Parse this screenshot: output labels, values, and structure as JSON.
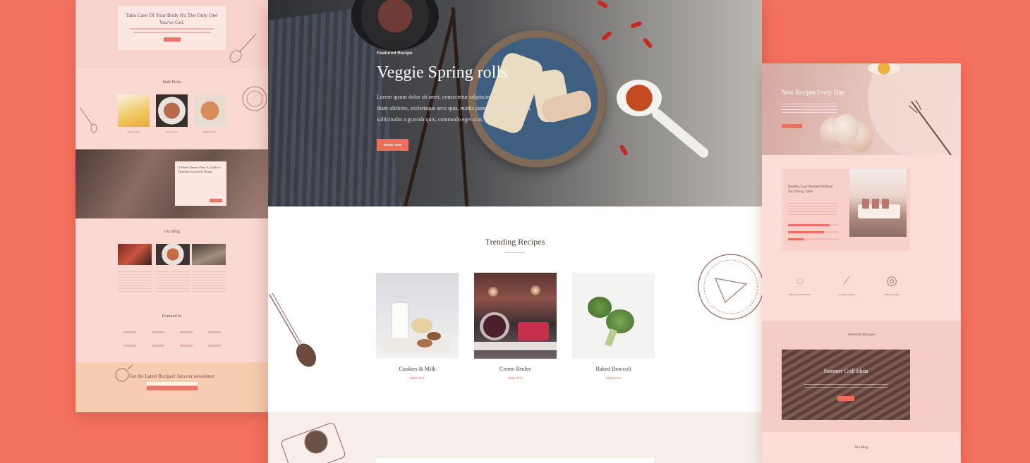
{
  "colors": {
    "background": "#f4735f",
    "accent": "#ee6e5e",
    "pink_bg": "#fbd9d3",
    "dark_text": "#4a3a37"
  },
  "left_mockup": {
    "top_card_title": "Take Care Of Your Body It's The Only One You've Got.",
    "staff_picks_title": "Staff Picks",
    "staff_picks": [
      {
        "caption": "Orange Juice"
      },
      {
        "caption": "Roast Crab"
      },
      {
        "caption": "Baked Bread"
      }
    ],
    "feature_card_title": "4-Week Dinner Plan: A Guide to Healthier Lunch & Dinner",
    "blog_title": "Our Blog",
    "blog_posts": [
      {
        "title": "Summer Grill Ideas"
      },
      {
        "title": "Best Crabbed Recipe Pakastan"
      },
      {
        "title": "Baking Bread at Home"
      }
    ],
    "featured_in_title": "Featured In",
    "newsletter_title": "Get the Latest Recipes! Join our newsletter"
  },
  "center_mockup": {
    "hero": {
      "label": "Featured Recipe",
      "title": "Veggie Spring rolls",
      "text": "Lorem ipsum dolor sit amet, consectetur adipiscing elit. Sed nec diam ultricies, scelerisque arcu quis, mattis purus. Morbi tellus nibh, sollicitudin a gravida quis, commodo eget cras.",
      "button": "MAKE THIS"
    },
    "trending_title": "Trending Recipes",
    "recipes": [
      {
        "name": "Cookies & Milk",
        "link": "Make This"
      },
      {
        "name": "Creme Brulee",
        "link": "Make This"
      },
      {
        "name": "Baked Broccoli",
        "link": "Make This"
      }
    ]
  },
  "right_mockup": {
    "hero_title": "New Recipes Every Day",
    "block_title": "Healthy Easy Recipes Without Sacrificing Taste",
    "progress": [
      0.82,
      0.71,
      0.3
    ],
    "features": [
      {
        "icon": "pan-icon",
        "caption": "Healthy Quick Dishes"
      },
      {
        "icon": "knife-icon",
        "caption": "All Skills Skilled"
      },
      {
        "icon": "cake-icon",
        "caption": "Meal Planning"
      }
    ],
    "featured_title": "Featured Recipes",
    "grill_title": "Summer Grill Ideas",
    "blog_title": "Our Blog"
  }
}
